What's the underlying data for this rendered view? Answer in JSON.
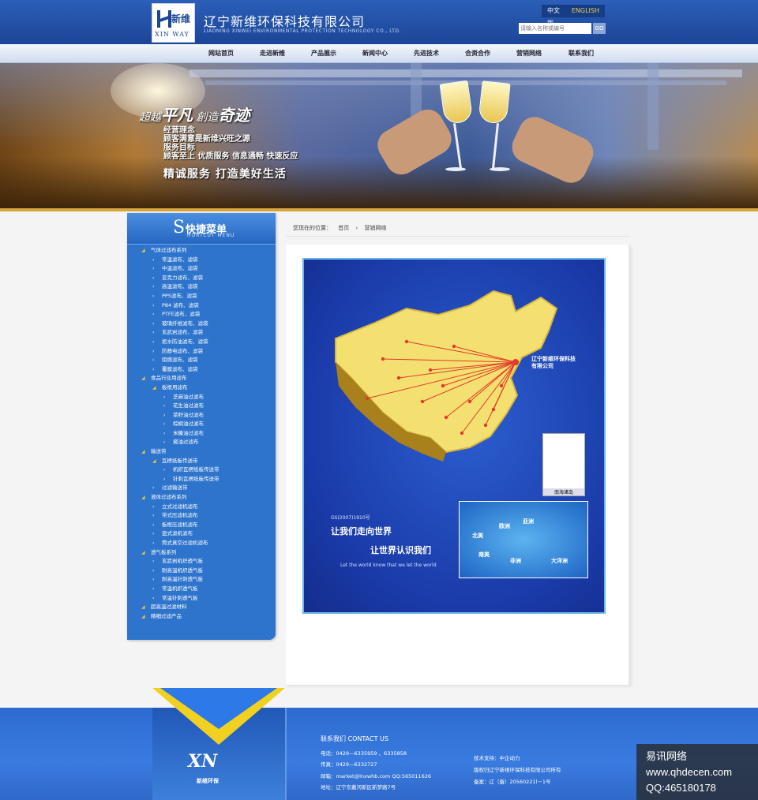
{
  "header": {
    "logo_cn": "新维",
    "logo_en": "XIN WAY",
    "company_cn": "辽宁新维环保科技有限公司",
    "company_en": "LIAONING XINWEI ENVIRONMENTAL PROTECTION TECHNOLOGY CO., LTD.",
    "lang_cn": "中文版",
    "lang_en": "ENGLISH",
    "search_placeholder": "请输入名称或编号",
    "search_button": "GO"
  },
  "nav": [
    "网站首页",
    "走进新维",
    "产品展示",
    "新闻中心",
    "先进技术",
    "合资合作",
    "营销网络",
    "联系我们"
  ],
  "banner": {
    "slogan_a": "超越",
    "slogan_b": "平凡",
    "slogan_c": "創造",
    "slogan_d": "奇迹",
    "lines": [
      "经营理念",
      "顾客满意是新维兴旺之源",
      "服务目标",
      "顾客至上 优质服务 信息通畅 快速反应"
    ],
    "big": "精诚服务 打造美好生活"
  },
  "sidebar": {
    "s_letter": "S",
    "title": "快捷菜单",
    "subtitle": "HORTCUT MENU",
    "items": [
      {
        "level": "lv1",
        "label": "气体过滤布系列"
      },
      {
        "level": "lv2",
        "label": "常温滤布、滤袋"
      },
      {
        "level": "lv2",
        "label": "中温滤布、滤袋"
      },
      {
        "level": "lv2",
        "label": "亚克力滤布、滤袋"
      },
      {
        "level": "lv2",
        "label": "高温滤布、滤袋"
      },
      {
        "level": "lv2",
        "label": "PPS滤布、滤袋"
      },
      {
        "level": "lv2",
        "label": "P84 滤布、滤袋"
      },
      {
        "level": "lv2",
        "label": "PTFE滤布、滤袋"
      },
      {
        "level": "lv2",
        "label": "玻璃纤维滤布、滤袋"
      },
      {
        "level": "lv2",
        "label": "玄武岩滤布、滤袋"
      },
      {
        "level": "lv2",
        "label": "拒水防油滤布、滤袋"
      },
      {
        "level": "lv2",
        "label": "防静电滤布、滤袋"
      },
      {
        "level": "lv2",
        "label": "阻燃滤布、滤袋"
      },
      {
        "level": "lv2",
        "label": "覆膜滤布、滤袋"
      },
      {
        "level": "lv1",
        "label": "食品行业用滤布"
      },
      {
        "level": "lv2o",
        "label": "板框用滤布"
      },
      {
        "level": "lv3",
        "label": "芝麻油过滤布"
      },
      {
        "level": "lv3",
        "label": "花生油过滤布"
      },
      {
        "level": "lv3",
        "label": "菜籽油过滤布"
      },
      {
        "level": "lv3",
        "label": "棕榈油过滤布"
      },
      {
        "level": "lv3",
        "label": "米糠油过滤布"
      },
      {
        "level": "lv3",
        "label": "酱油过滤布"
      },
      {
        "level": "lv1",
        "label": "输送带"
      },
      {
        "level": "lv2o",
        "label": "瓦楞纸板传送带"
      },
      {
        "level": "lv3",
        "label": "机织瓦楞纸板传送带"
      },
      {
        "level": "lv3",
        "label": "针刺瓦楞纸板传送带"
      },
      {
        "level": "lv2",
        "label": "过滤输送带"
      },
      {
        "level": "lv1",
        "label": "液体过滤布系列"
      },
      {
        "level": "lv2",
        "label": "立式过滤机滤布"
      },
      {
        "level": "lv2",
        "label": "带式压滤机滤布"
      },
      {
        "level": "lv2",
        "label": "板框压滤机滤布"
      },
      {
        "level": "lv2",
        "label": "盘式滤机滤布"
      },
      {
        "level": "lv2",
        "label": "筒式真空过滤机滤布"
      },
      {
        "level": "lv1",
        "label": "透气板系列"
      },
      {
        "level": "lv2",
        "label": "玄武岩机织透气板"
      },
      {
        "level": "lv2",
        "label": "耐高温机织透气板"
      },
      {
        "level": "lv2",
        "label": "耐高温针刺透气板"
      },
      {
        "level": "lv2",
        "label": "常温机织透气板"
      },
      {
        "level": "lv2",
        "label": "常温针刺透气板"
      },
      {
        "level": "lv1",
        "label": "超高温过滤材料"
      },
      {
        "level": "lv1",
        "label": "精细过滤产品"
      }
    ]
  },
  "breadcrumb": {
    "prefix": "您现在的位置：",
    "home": "首页",
    "sep": "›",
    "current": "营销网络"
  },
  "map": {
    "code": "GS(2007)1910号",
    "slogan1": "让我们走向世界",
    "slogan2": "让世界认识我们",
    "slogan_en": "Let the world know that we let the world",
    "company": "辽宁新维环保科技有限公司",
    "inset_label": "南海诸岛",
    "continents": [
      "欧洲",
      "亚洲",
      "北美",
      "南美",
      "非洲",
      "大洋洲"
    ],
    "land_color": "#f4e070",
    "route_color": "#e23a2a"
  },
  "footer": {
    "logo": "XN",
    "logo_cn": "新维环保",
    "contact_title": "联系我们 CONTACT US",
    "phone": "电话：0429—6335959 、6335858",
    "fax": "传真：0429—6332727",
    "email": "邮箱：market@lnxwhb.com QQ:565011626",
    "address": "地址：辽宁东戴河新区新梦路7号",
    "support": "技术支持：中企动力",
    "copyright": "版权归辽宁新维环保科技有限公司所有",
    "icp": "备案：辽（备）20560221l－1号"
  },
  "watermark": {
    "line1": "易讯网络",
    "line2": "www.qhdecen.com",
    "line3": "QQ:465180178"
  }
}
